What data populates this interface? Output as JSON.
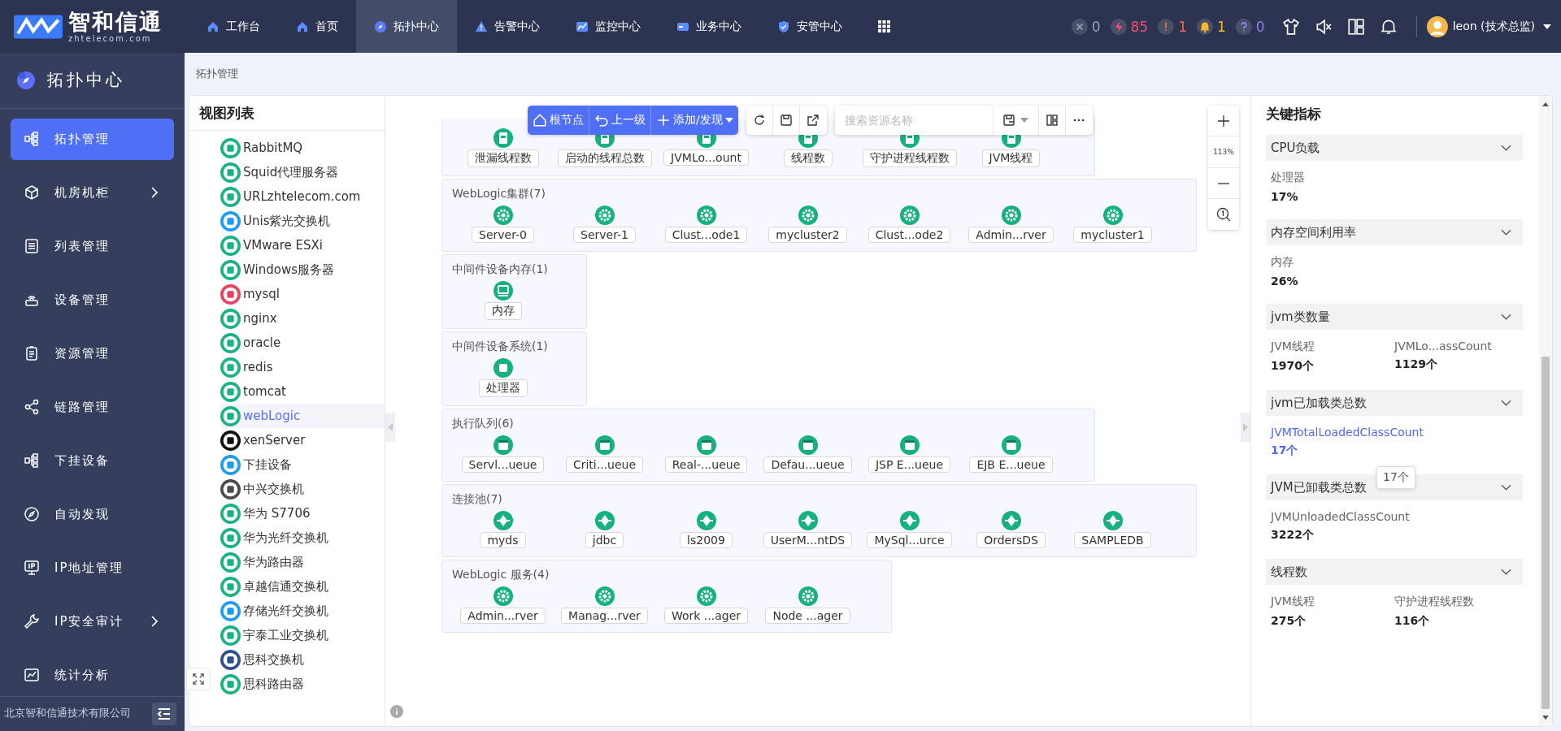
{
  "brand": {
    "name": "智和信通",
    "domain": "zhtelecom.com"
  },
  "nav": [
    {
      "label": "工作台",
      "kind": "home",
      "selected": false
    },
    {
      "label": "首页",
      "kind": "home",
      "selected": false
    },
    {
      "label": "拓扑中心",
      "kind": "compass",
      "selected": true
    },
    {
      "label": "告警中心",
      "kind": "warning",
      "selected": false
    },
    {
      "label": "监控中心",
      "kind": "chart",
      "selected": false
    },
    {
      "label": "业务中心",
      "kind": "card",
      "selected": false
    },
    {
      "label": "安管中心",
      "kind": "shield",
      "selected": false
    }
  ],
  "counters": [
    {
      "kind": "close",
      "count": "0",
      "color": "#9aa0b4"
    },
    {
      "kind": "bolt",
      "count": "85",
      "color": "#f0506e"
    },
    {
      "kind": "alert",
      "count": "1",
      "color": "#ef6a4c"
    },
    {
      "kind": "bell",
      "count": "1",
      "color": "#f5b82e"
    },
    {
      "kind": "help",
      "count": "0",
      "color": "#8f7ff2"
    }
  ],
  "user": {
    "name": "leon (技术总监)"
  },
  "sidebar": {
    "title": "拓扑中心",
    "footer": "北京智和信通技术有限公司",
    "items": [
      {
        "label": "拓扑管理",
        "kind": "tree",
        "selected": true,
        "submenu": false
      },
      {
        "label": "机房机柜",
        "kind": "cube",
        "selected": false,
        "submenu": true
      },
      {
        "label": "列表管理",
        "kind": "list",
        "selected": false,
        "submenu": false
      },
      {
        "label": "设备管理",
        "kind": "router",
        "selected": false,
        "submenu": false
      },
      {
        "label": "资源管理",
        "kind": "clipboard",
        "selected": false,
        "submenu": false
      },
      {
        "label": "链路管理",
        "kind": "link",
        "selected": false,
        "submenu": false
      },
      {
        "label": "下挂设备",
        "kind": "tree",
        "selected": false,
        "submenu": false
      },
      {
        "label": "自动发现",
        "kind": "compass",
        "selected": false,
        "submenu": false
      },
      {
        "label": "IP地址管理",
        "kind": "ip",
        "selected": false,
        "submenu": false
      },
      {
        "label": "IP安全审计",
        "kind": "wrench",
        "selected": false,
        "submenu": true
      },
      {
        "label": "统计分析",
        "kind": "chart",
        "selected": false,
        "submenu": false
      }
    ]
  },
  "breadcrumb": "拓扑管理",
  "view_list": {
    "title": "视图列表",
    "items": [
      {
        "label": "RabbitMQ",
        "color": "#19b283",
        "selected": false
      },
      {
        "label": "Squid代理服务器",
        "color": "#19b283",
        "selected": false
      },
      {
        "label": "URLzhtelecom.com",
        "color": "#19b283",
        "selected": false
      },
      {
        "label": "Unis紫光交换机",
        "color": "#1e9df0",
        "selected": false
      },
      {
        "label": "VMware ESXi",
        "color": "#19b283",
        "selected": false
      },
      {
        "label": "Windows服务器",
        "color": "#19b283",
        "selected": false
      },
      {
        "label": "mysql",
        "color": "#ea4160",
        "selected": false
      },
      {
        "label": "nginx",
        "color": "#19b283",
        "selected": false
      },
      {
        "label": "oracle",
        "color": "#19b283",
        "selected": false
      },
      {
        "label": "redis",
        "color": "#19b283",
        "selected": false
      },
      {
        "label": "tomcat",
        "color": "#19b283",
        "selected": false
      },
      {
        "label": "webLogic",
        "color": "#19b283",
        "selected": true
      },
      {
        "label": "xenServer",
        "color": "#111111",
        "selected": false
      },
      {
        "label": "下挂设备",
        "color": "#1e9df0",
        "selected": false
      },
      {
        "label": "中兴交换机",
        "color": "#4a4a4a",
        "selected": false
      },
      {
        "label": "华为 S7706",
        "color": "#19b283",
        "selected": false
      },
      {
        "label": "华为光纤交换机",
        "color": "#19b283",
        "selected": false
      },
      {
        "label": "华为路由器",
        "color": "#19b283",
        "selected": false
      },
      {
        "label": "卓越信通交换机",
        "color": "#19b283",
        "selected": false
      },
      {
        "label": "存储光纤交换机",
        "color": "#1e9df0",
        "selected": false
      },
      {
        "label": "宇泰工业交换机",
        "color": "#19b283",
        "selected": false
      },
      {
        "label": "思科交换机",
        "color": "#2f4f8f",
        "selected": false
      },
      {
        "label": "思科路由器",
        "color": "#19b283",
        "selected": false
      }
    ]
  },
  "toolbar": {
    "buttons": [
      "根节点",
      "上一级",
      "添加/发现"
    ],
    "search": {
      "placeholder": "搜索资源名称"
    },
    "zoom": "113%"
  },
  "groups": [
    {
      "kind": "jvm",
      "nodes": [
        "泄漏线程数",
        "启动的线程总数",
        "JVMLo...ount",
        "线程数",
        "守护进程线程数",
        "JVM线程"
      ]
    },
    {
      "title": "WebLogic集群(7)",
      "kind": "gear",
      "nodes": [
        "Server-0",
        "Server-1",
        "Clust...ode1",
        "mycluster2",
        "Clust...ode2",
        "Admin...rver",
        "mycluster1"
      ]
    },
    {
      "title": "中间件设备内存(1)",
      "kind": "monitor",
      "nodes": [
        "内存"
      ]
    },
    {
      "title": "中间件设备系统(1)",
      "kind": "square",
      "nodes": [
        "处理器"
      ]
    },
    {
      "title": "执行队列(6)",
      "kind": "window",
      "nodes": [
        "Servl...ueue",
        "Criti...ueue",
        "Real-...ueue",
        "Defau...ueue",
        "JSP E...ueue",
        "EJB E...ueue"
      ]
    },
    {
      "title": "连接池(7)",
      "kind": "db",
      "nodes": [
        "myds",
        "jdbc",
        "ls2009",
        "UserM...ntDS",
        "MySql...urce",
        "OrdersDS",
        "SAMPLEDB"
      ]
    },
    {
      "title": "WebLogic 服务(4)",
      "kind": "gear",
      "nodes": [
        "Admin...rver",
        "Manag...rver",
        "Work ...ager",
        "Node ...ager"
      ]
    }
  ],
  "metrics_panel": {
    "title": "关键指标",
    "sections": [
      {
        "title": "CPU负载",
        "metrics": [
          {
            "label": "处理器",
            "value": "17%",
            "selected": false
          }
        ]
      },
      {
        "title": "内存空间利用率",
        "metrics": [
          {
            "label": "内存",
            "value": "26%",
            "selected": false
          }
        ]
      },
      {
        "title": "jvm类数量",
        "metrics": [
          {
            "label": "JVM线程",
            "value": "1970个",
            "selected": false
          },
          {
            "label": "JVMLo...assCount",
            "value": "1129个",
            "selected": false
          }
        ]
      },
      {
        "title": "jvm已加载类总数",
        "metrics": [
          {
            "label": "JVMTotalLoadedClassCount",
            "value": "17个",
            "selected": true
          }
        ]
      },
      {
        "title": "JVM已卸载类总数",
        "metrics": [
          {
            "label": "JVMUnloadedClassCount",
            "value": "3222个",
            "selected": false
          }
        ]
      },
      {
        "title": "线程数",
        "metrics": [
          {
            "label": "JVM线程",
            "value": "275个",
            "selected": false
          },
          {
            "label": "守护进程线程数",
            "value": "116个",
            "selected": false
          }
        ]
      }
    ],
    "tooltip": "17个"
  }
}
